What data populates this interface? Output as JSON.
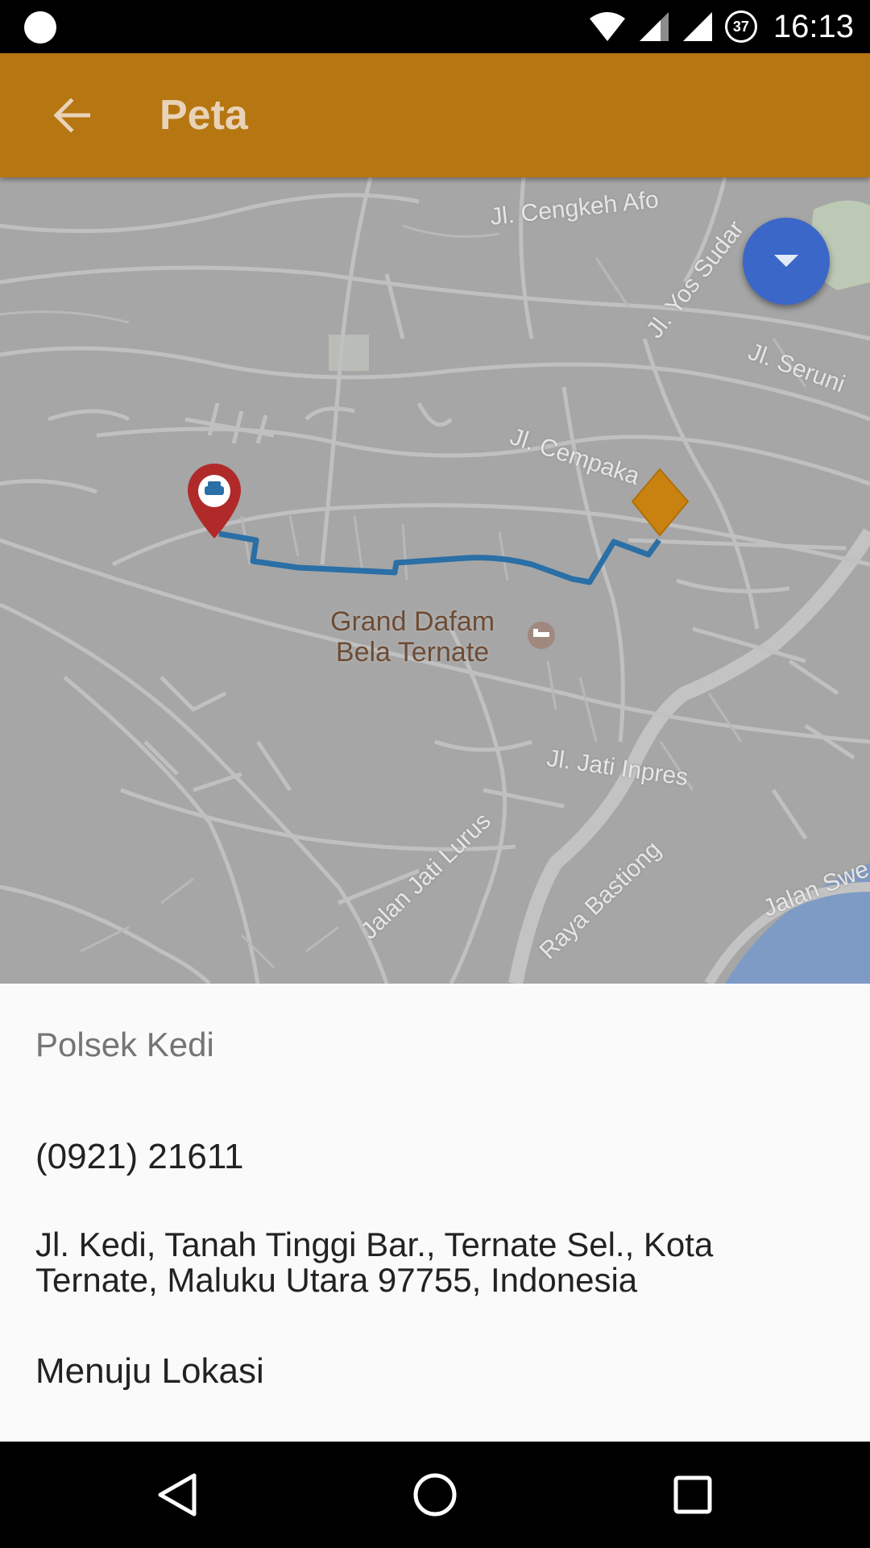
{
  "status_bar": {
    "time": "16:13",
    "battery_level": "37"
  },
  "app_bar": {
    "title": "Peta"
  },
  "map": {
    "street_labels": [
      "Jl. Cengkeh Afo",
      "Jl. Yos Sudar",
      "Jl. Seruni",
      "Jl. Cempaka",
      "Jl. Jati Inpres",
      "Jalan Jati Lurus",
      "Raya Bastiong",
      "Jalan Swe"
    ],
    "poi": {
      "line1": "Grand Dafam",
      "line2": "Bela Ternate"
    },
    "route_color": "#2a6fa6",
    "origin_marker_color": "#b02a2a",
    "destination_marker_color": "#c9820f"
  },
  "fab": {
    "icon": "chevron-down-icon",
    "color": "#3b67c8"
  },
  "place": {
    "name": "Polsek Kedi",
    "phone": "(0921) 21611",
    "address": "Jl. Kedi, Tanah Tinggi Bar., Ternate Sel., Kota Ternate, Maluku Utara 97755, Indonesia",
    "directions_label": "Menuju Lokasi"
  },
  "colors": {
    "app_bar": "#b67611",
    "sheet": "#fafafa"
  }
}
